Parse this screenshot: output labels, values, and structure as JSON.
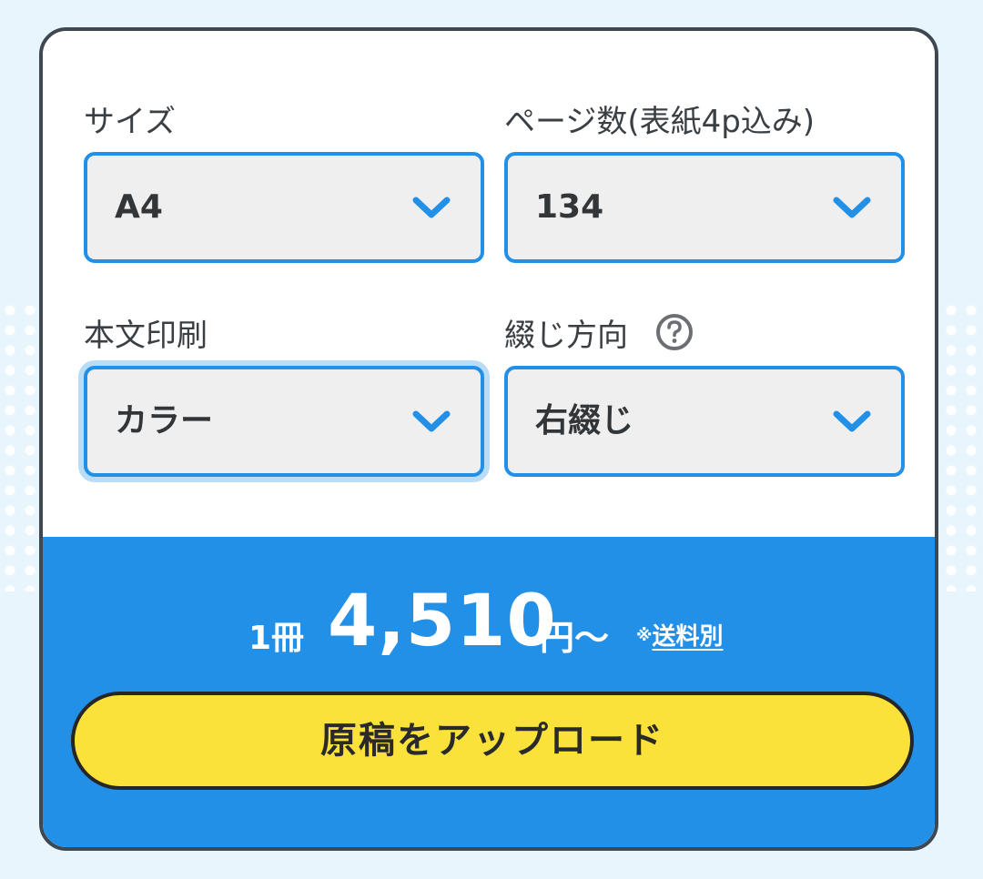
{
  "form": {
    "size": {
      "label": "サイズ",
      "value": "A4"
    },
    "pages": {
      "label": "ページ数(表紙4p込み)",
      "value": "134"
    },
    "print": {
      "label": "本文印刷",
      "value": "カラー"
    },
    "binding": {
      "label": "綴じ方向",
      "value": "右綴じ",
      "help_icon": "question-circle-icon"
    }
  },
  "price": {
    "quantity": "1冊",
    "amount": "4,510",
    "unit": "円〜",
    "note_mark": "※",
    "note_link": "送料別"
  },
  "upload_button": {
    "label": "原稿をアップロード"
  },
  "colors": {
    "accent": "#2390e8",
    "button": "#fbe23a",
    "select_bg": "#efefef",
    "border_dark": "#3f4850"
  }
}
